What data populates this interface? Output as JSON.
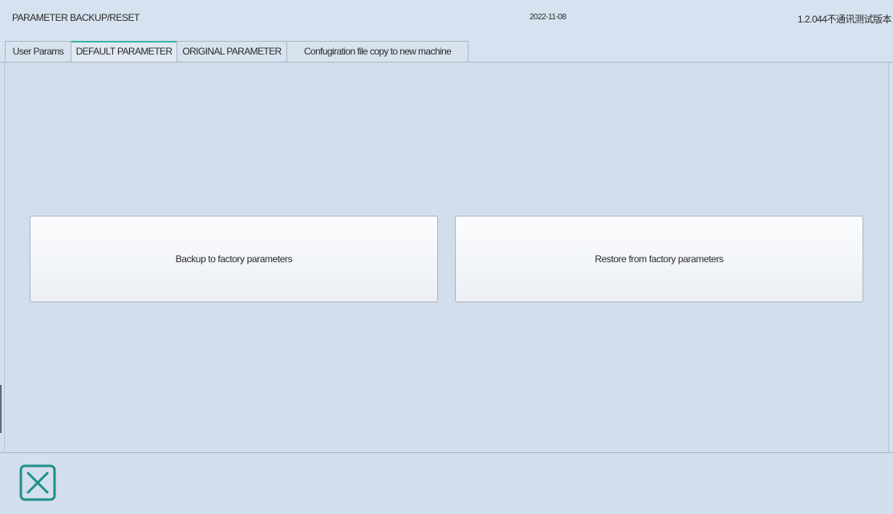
{
  "header": {
    "title": "PARAMETER BACKUP/RESET",
    "date": "2022-11-08",
    "version": "1.2.044不通讯测试版本"
  },
  "tabs": [
    {
      "label": "User Params",
      "active": false
    },
    {
      "label": "DEFAULT PARAMETER",
      "active": true
    },
    {
      "label": "ORIGINAL PARAMETER",
      "active": false
    },
    {
      "label": "Confugiration file copy  to new machine",
      "active": false
    }
  ],
  "actions": {
    "backup_label": "Backup to factory parameters",
    "restore_label": "Restore from factory parameters"
  },
  "footer": {
    "close_icon": "close-x-icon"
  },
  "colors": {
    "background": "#d3dfec",
    "active_tab_accent": "#3bb3a3",
    "close_icon": "#1f8f8a"
  }
}
